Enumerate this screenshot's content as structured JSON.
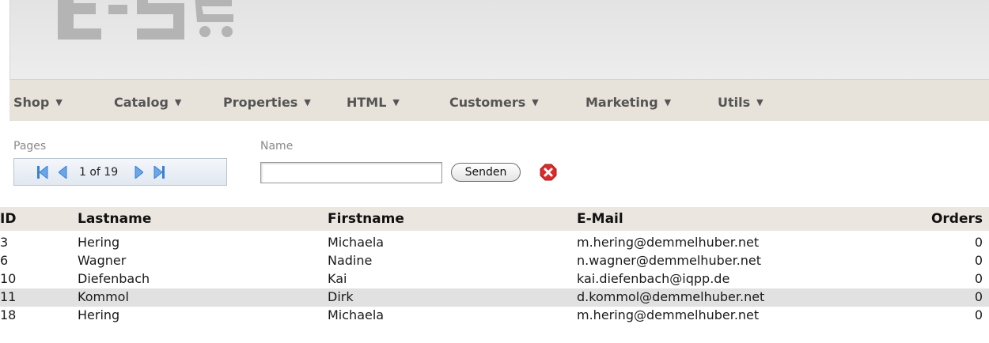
{
  "logo": {
    "text": "ES"
  },
  "nav": {
    "items": [
      {
        "label": "Shop",
        "arrow": "▼"
      },
      {
        "label": "Catalog",
        "arrow": "▼"
      },
      {
        "label": "Properties",
        "arrow": "▼"
      },
      {
        "label": "HTML",
        "arrow": "▼"
      },
      {
        "label": "Customers",
        "arrow": "▼"
      },
      {
        "label": "Marketing",
        "arrow": "▼"
      },
      {
        "label": "Utils",
        "arrow": "▼"
      }
    ]
  },
  "filters": {
    "pages_label": "Pages",
    "name_label": "Name",
    "pager_text": "1 of 19",
    "name_value": "",
    "send_label": "Senden"
  },
  "table": {
    "headers": {
      "id": "ID",
      "lastname": "Lastname",
      "firstname": "Firstname",
      "email": "E-Mail",
      "orders": "Orders"
    },
    "rows": [
      {
        "id": "3",
        "lastname": "Hering",
        "firstname": "Michaela",
        "email": "m.hering@demmelhuber.net",
        "orders": "0"
      },
      {
        "id": "6",
        "lastname": "Wagner",
        "firstname": "Nadine",
        "email": "n.wagner@demmelhuber.net",
        "orders": "0"
      },
      {
        "id": "10",
        "lastname": "Diefenbach",
        "firstname": "Kai",
        "email": "kai.diefenbach@iqpp.de",
        "orders": "0"
      },
      {
        "id": "11",
        "lastname": "Kommol",
        "firstname": "Dirk",
        "email": "d.kommol@demmelhuber.net",
        "orders": "0"
      },
      {
        "id": "18",
        "lastname": "Hering",
        "firstname": "Michaela",
        "email": "m.hering@demmelhuber.net",
        "orders": "0"
      }
    ],
    "highlighted_row_index": 3
  },
  "colors": {
    "navbar_bg": "#e7e2da",
    "header_bg": "#e3e3e3",
    "pager_icon": "#3a7fd0",
    "clear_icon": "#d92b2b",
    "row_highlight": "#e1e1e1"
  }
}
